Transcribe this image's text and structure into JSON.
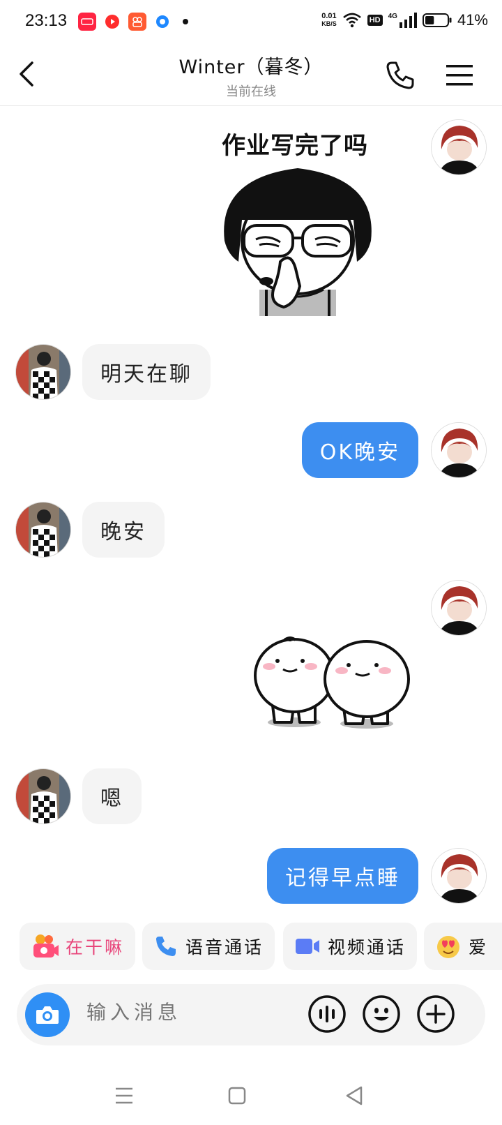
{
  "status_bar": {
    "time": "23:13",
    "net_speed_value": "0.01",
    "net_speed_unit": "KB/S",
    "hd_badge": "HD",
    "network_type": "4G",
    "battery_percent": "41%",
    "battery_level": 0.41,
    "notification_icons": [
      "xiaohongshu-icon",
      "video-app-icon",
      "kuaishou-icon",
      "browser-icon"
    ]
  },
  "header": {
    "title": "Winter（暮冬）",
    "subtitle": "当前在线",
    "icons": [
      "back-arrow-icon",
      "phone-icon",
      "menu-icon"
    ]
  },
  "messages": [
    {
      "side": "out",
      "type": "sticker",
      "caption": "作业写完了吗",
      "sticker": "girl-bowl-cut-sticker"
    },
    {
      "side": "in",
      "type": "text",
      "text": "明天在聊"
    },
    {
      "side": "out",
      "type": "text",
      "text": "OK晚安"
    },
    {
      "side": "in",
      "type": "text",
      "text": "晚安"
    },
    {
      "side": "out",
      "type": "sticker",
      "sticker": "two-dumplings-sticker"
    },
    {
      "side": "in",
      "type": "text",
      "text": "嗯"
    },
    {
      "side": "out",
      "type": "text",
      "text": "记得早点睡"
    }
  ],
  "quick_actions": [
    {
      "label": "在干嘛",
      "icon": "camera-emoji-icon",
      "color": "#e8457a"
    },
    {
      "label": "语音通话",
      "icon": "phone-icon",
      "color": "#222222"
    },
    {
      "label": "视频通话",
      "icon": "video-camera-icon",
      "color": "#222222"
    },
    {
      "label": "爱",
      "icon": "love-face-icon",
      "color": "#222222"
    }
  ],
  "composer": {
    "placeholder": "输入消息",
    "icons": [
      "camera-icon",
      "voice-icon",
      "emoji-icon",
      "plus-icon"
    ]
  },
  "colors": {
    "accent": "#3d8ef0",
    "incoming_bubble": "#f4f4f4",
    "camera_button": "#2f8ff5"
  }
}
